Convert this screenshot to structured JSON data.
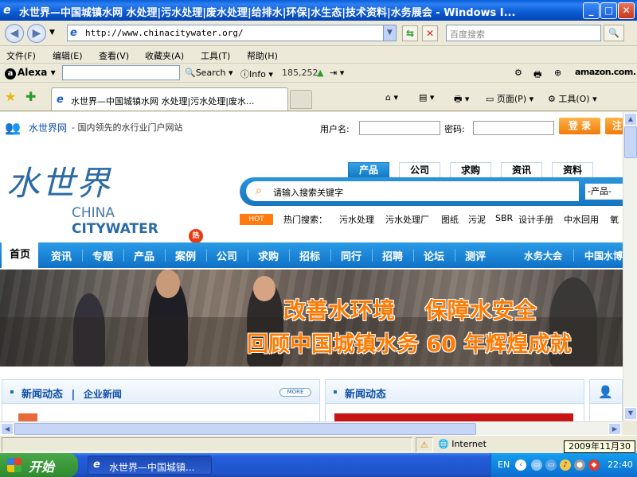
{
  "window": {
    "title": "水世界—中国城镇水网 水处理|污水处理|废水处理|给排水|环保|水生态|技术资料|水务展会 - Windows I...",
    "minimize": "_",
    "maximize": "□",
    "close": "✕"
  },
  "addressbar": {
    "url": "http://www.chinacitywater.org/",
    "search_placeholder": "百度搜索"
  },
  "menu": {
    "file": "文件(F)",
    "edit": "编辑(E)",
    "view": "查看(V)",
    "favorites": "收藏夹(A)",
    "tools": "工具(T)",
    "help": "帮助(H)"
  },
  "alexa": {
    "logo": "Alexa",
    "search": "Search",
    "info": "Info",
    "rank": "185,252",
    "amazon": "amazon.com."
  },
  "tabs": {
    "active_title": "水世界—中国城镇水网 水处理|污水处理|废水..."
  },
  "commands": {
    "page": "页面(P)",
    "tools": "工具(O)"
  },
  "page": {
    "topstrip": {
      "site_name": "水世界网",
      "slogan": "-  国内领先的水行业门户网站",
      "username_label": "用户名:",
      "password_label": "密码:",
      "login": "登 录",
      "register": "注"
    },
    "logo": {
      "cn": "水世界",
      "en_prefix": "CHINA ",
      "en_suffix": "CITYWATER"
    },
    "category_tabs": [
      "产品",
      "公司",
      "求购",
      "资讯",
      "资料"
    ],
    "search": {
      "placeholder": "请输入搜索关键字",
      "select": "-产品-"
    },
    "hot": {
      "badge": "HOT",
      "label": "热门搜索：",
      "links": [
        "污水处理",
        "污水处理厂",
        "图纸",
        "污泥",
        "SBR",
        "设计手册",
        "中水回用",
        "氧"
      ]
    },
    "nav": {
      "items": [
        "首页",
        "资讯",
        "专题",
        "产品",
        "案例",
        "公司",
        "求购",
        "招标",
        "同行",
        "招聘",
        "论坛",
        "测评",
        "水务大会",
        "中国水博"
      ],
      "hot_badge": "热"
    },
    "banner": {
      "line1": "改善水环境　 保障水安全",
      "line2": "回顾中国城镇水务 60 年辉煌成就"
    },
    "panels": {
      "left_title": "新闻动态",
      "left_sep": "|",
      "left_sub": "企业新闻",
      "more": "MORE",
      "mid_title": "新闻动态"
    }
  },
  "statusbar": {
    "zone": "Internet",
    "date_tooltip": "2009年11月30日"
  },
  "taskbar": {
    "start": "开始",
    "window_item": "水世界—中国城镇...",
    "lang": "EN",
    "clock": "22:40"
  }
}
